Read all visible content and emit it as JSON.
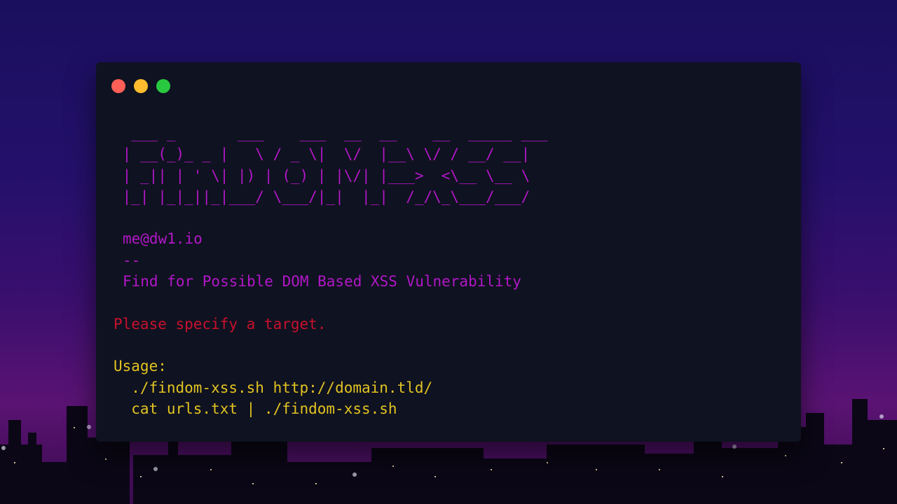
{
  "window": {
    "controls": [
      {
        "name": "close",
        "color": "#ff5f57"
      },
      {
        "name": "minimize",
        "color": "#febc2e"
      },
      {
        "name": "maximize",
        "color": "#28c840"
      }
    ]
  },
  "terminal": {
    "banner": [
      "  ___ _       ___    ___  __  __    __  _____ ___",
      " | __(_)_ _ |   \\ / _ \\|  \\/  |__\\ \\/ / __/ __|",
      " | _|| | ' \\| |) | (_) | |\\/| |___>  <\\__ \\__ \\",
      " |_| |_|_||_|___/ \\___/|_|  |_|  /_/\\_\\___/___/"
    ],
    "author": "me@dw1.io",
    "separator": "--",
    "description": "Find for Possible DOM Based XSS Vulnerability",
    "error": "Please specify a target.",
    "usage_label": "Usage:",
    "usage_lines": [
      "  ./findom-xss.sh http://domain.tld/",
      "  cat urls.txt | ./findom-xss.sh"
    ]
  },
  "colors": {
    "banner": "#b217c8",
    "error": "#c8102e",
    "usage": "#e2c322",
    "terminal_bg": "#0f1220"
  }
}
